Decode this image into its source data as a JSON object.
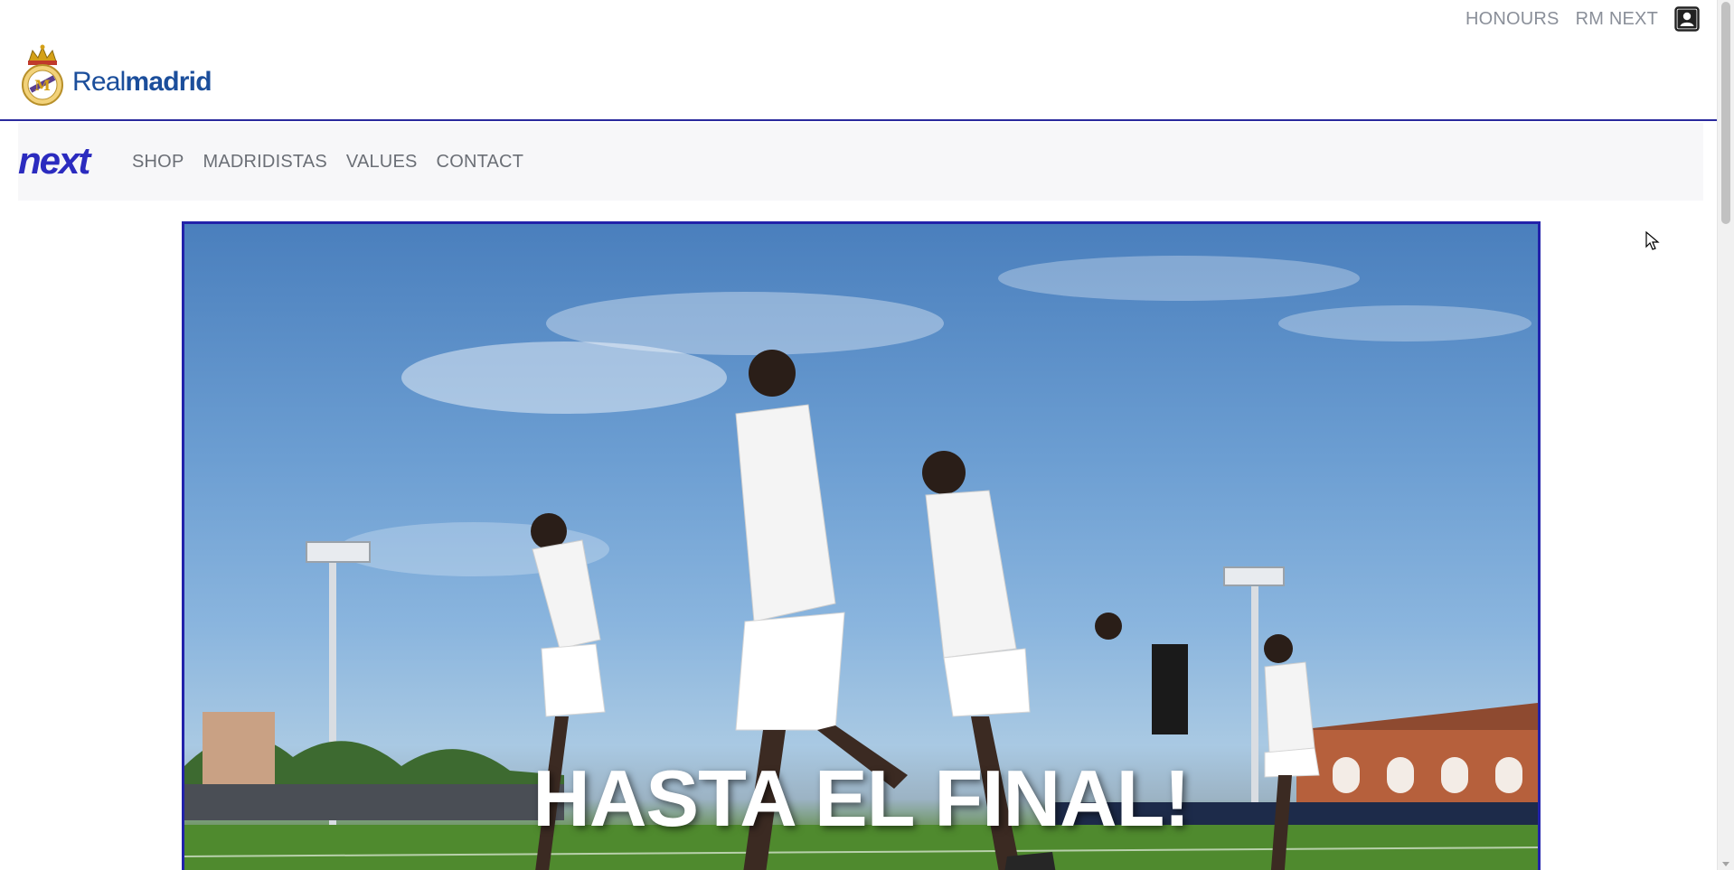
{
  "top_links": {
    "honours": "HONOURS",
    "rm_next": "RM NEXT",
    "account_icon": "user-account-icon"
  },
  "brand": {
    "wordmark_light": "Real",
    "wordmark_bold": "madrid",
    "crest_icon": "real-madrid-crest-icon"
  },
  "nav": {
    "logo_text": "next",
    "items": [
      "SHOP",
      "MADRIDISTAS",
      "VALUES",
      "CONTACT"
    ]
  },
  "hero": {
    "title": "HASTA EL FINAL!"
  },
  "colors": {
    "accent": "#2a2a9e",
    "brand_blue": "#1b4e9b",
    "nav_text": "#6b6f76",
    "top_link_text": "#8a8f99"
  }
}
